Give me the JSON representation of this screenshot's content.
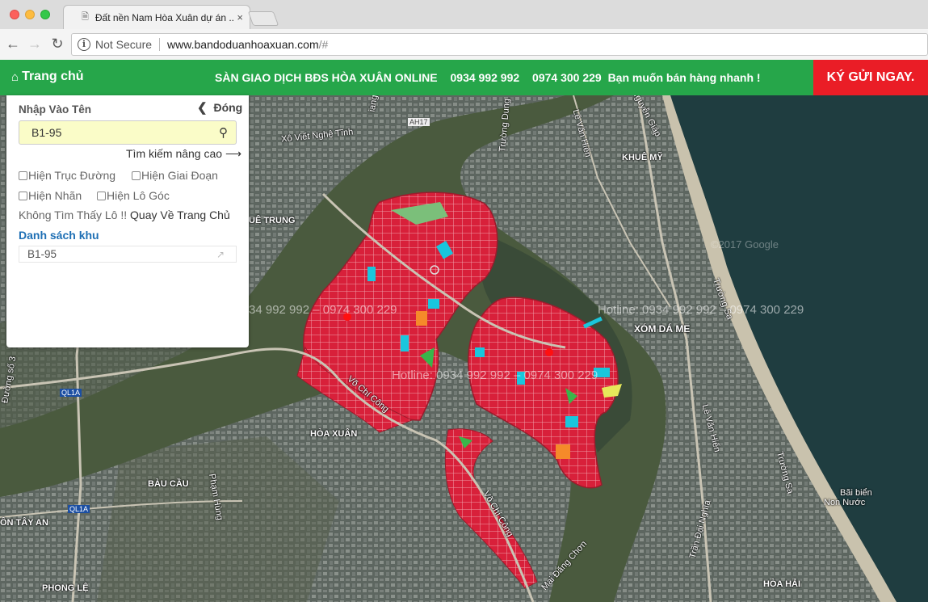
{
  "browser": {
    "tab_title": "Đất nền Nam Hòa Xuân dự án ...",
    "tab_close": "×",
    "security": "Not Secure",
    "url_host": "www.bandoduanhoaxuan.com",
    "url_path": "/#"
  },
  "topnav": {
    "home": "Trang chủ",
    "headline": "SÀN GIAO DỊCH BĐS HÒA XUÂN ONLINE",
    "phone1": "0934 992 992",
    "phone2": "0974 300 229",
    "sell_prompt": "Bạn muốn bán hàng nhanh !",
    "cta": "KÝ GỬI NGAY."
  },
  "panel": {
    "label": "Nhập Vào Tên",
    "close": "Đóng",
    "search_value": "B1-95",
    "advanced": "Tìm kiếm nâng cao",
    "checkboxes": [
      "Hiện Trục Đường",
      "Hiện Giai Đoạn",
      "Hiện Nhãn",
      "Hiện Lô Góc"
    ],
    "not_found": "Không Tìm Thấy Lô !!",
    "go_home": "Quay Về Trang Chủ",
    "area_list_title": "Danh sách khu",
    "area_items": [
      "B1-95"
    ]
  },
  "map": {
    "watermark": "Hotline: 0934 992 992 – 0974 300 229",
    "watermark_partial": "34 992 992 – 0974 300 229",
    "copyright": "©2017 Google",
    "labels": {
      "xo_viet": "Xô Viết Nghệ Tĩnh",
      "ah17": "AH17",
      "khue_trung": "UÊ TRUNG",
      "khue_my": "KHUÊ MỸ",
      "xom_da_me": "XÓM DÁ ME",
      "truong_sa_top": "Trường Sa",
      "le_van_hien_top": "Lê Văn Hiến",
      "le_van_hien_bottom": "Lê Văn Hiến",
      "nguyen_giap": "Nguyễn Giáp",
      "truong_dung": "Trường Dung",
      "hoa_xuan": "HÒA XUÂN",
      "bau_cau": "BÀU CẦU",
      "ql1a_top": "QL1A",
      "ql1a_bottom": "QL1A",
      "pham_hung": "Phạm Hùng",
      "ton_tay_an": "ÔN TÂY AN",
      "phong_le": "PHONG LỆ",
      "vo_chi_cong": "Võ Chí Công",
      "vo_chi_cong_2": "Võ Chí Công",
      "mai_dang_chon": "Mai Đăng Chơn",
      "tran_dai_nghia": "Trần Đại Nghĩa",
      "truong_sa_bottom": "Trường Sa",
      "bai_bien": "Bãi biển",
      "non_nuoc": "Non Nước",
      "hoa_hai": "HÒA HẢI",
      "duong_so_3": "Đường số 3",
      "giang": "iang"
    }
  },
  "colors": {
    "nav_green": "#26a64a",
    "cta_red": "#ea1d26",
    "lot_red": "#d8203a",
    "link_blue": "#1e6fb4",
    "search_bg": "#fafcc8"
  }
}
